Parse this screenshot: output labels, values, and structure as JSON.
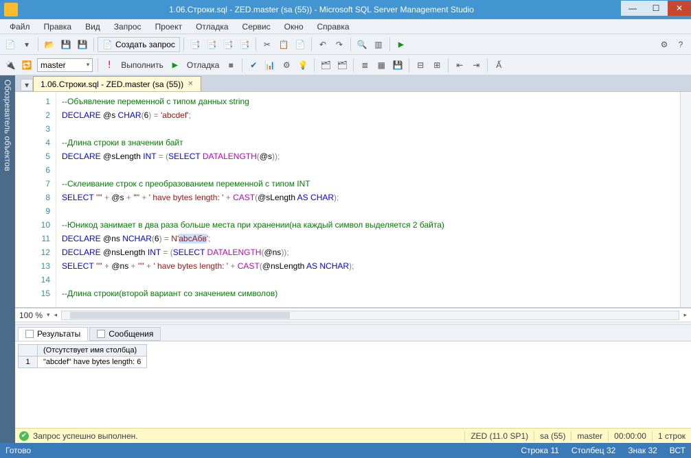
{
  "window": {
    "title": "1.06.Строки.sql - ZED.master (sa (55)) - Microsoft SQL Server Management Studio"
  },
  "menu": [
    "Файл",
    "Правка",
    "Вид",
    "Запрос",
    "Проект",
    "Отладка",
    "Сервис",
    "Окно",
    "Справка"
  ],
  "toolbar": {
    "new_query": "Создать запрос",
    "db_selected": "master",
    "execute": "Выполнить",
    "debug": "Отладка"
  },
  "sidepanel": {
    "title": "Обозреватель объектов"
  },
  "tab": {
    "label": "1.06.Строки.sql - ZED.master (sa (55))"
  },
  "code": {
    "lines": [
      {
        "n": 1,
        "tokens": [
          {
            "t": "--Объявление переменной с типом данных string",
            "c": "cm"
          }
        ]
      },
      {
        "n": 2,
        "tokens": [
          {
            "t": "DECLARE",
            "c": "kw"
          },
          {
            "t": " @s ",
            "c": "var"
          },
          {
            "t": "CHAR",
            "c": "kw"
          },
          {
            "t": "(",
            "c": "gray"
          },
          {
            "t": "6",
            "c": "var"
          },
          {
            "t": ")",
            "c": "gray"
          },
          {
            "t": " = ",
            "c": "gray"
          },
          {
            "t": "'abcdef'",
            "c": "str"
          },
          {
            "t": ";",
            "c": "gray"
          }
        ]
      },
      {
        "n": 3,
        "tokens": []
      },
      {
        "n": 4,
        "tokens": [
          {
            "t": "--Длина строки в значении байт",
            "c": "cm"
          }
        ]
      },
      {
        "n": 5,
        "tokens": [
          {
            "t": "DECLARE",
            "c": "kw"
          },
          {
            "t": " @sLength ",
            "c": "var"
          },
          {
            "t": "INT",
            "c": "kw"
          },
          {
            "t": " = ",
            "c": "gray"
          },
          {
            "t": "(",
            "c": "gray"
          },
          {
            "t": "SELECT",
            "c": "kw"
          },
          {
            "t": " ",
            "c": "var"
          },
          {
            "t": "DATALENGTH",
            "c": "fn"
          },
          {
            "t": "(",
            "c": "gray"
          },
          {
            "t": "@s",
            "c": "var"
          },
          {
            "t": "))",
            "c": "gray"
          },
          {
            "t": ";",
            "c": "gray"
          }
        ]
      },
      {
        "n": 6,
        "tokens": []
      },
      {
        "n": 7,
        "tokens": [
          {
            "t": "--Склеивание строк с преобразованием переменной с типом INT",
            "c": "cm"
          }
        ]
      },
      {
        "n": 8,
        "tokens": [
          {
            "t": "SELECT",
            "c": "kw"
          },
          {
            "t": " ",
            "c": "var"
          },
          {
            "t": "'\"'",
            "c": "str"
          },
          {
            "t": " + ",
            "c": "gray"
          },
          {
            "t": "@s",
            "c": "var"
          },
          {
            "t": " + ",
            "c": "gray"
          },
          {
            "t": "'\"'",
            "c": "str"
          },
          {
            "t": " + ",
            "c": "gray"
          },
          {
            "t": "' have bytes length: '",
            "c": "str"
          },
          {
            "t": " + ",
            "c": "gray"
          },
          {
            "t": "CAST",
            "c": "fn"
          },
          {
            "t": "(",
            "c": "gray"
          },
          {
            "t": "@sLength",
            "c": "var"
          },
          {
            "t": " ",
            "c": "var"
          },
          {
            "t": "AS",
            "c": "kw"
          },
          {
            "t": " ",
            "c": "var"
          },
          {
            "t": "CHAR",
            "c": "kw"
          },
          {
            "t": ")",
            "c": "gray"
          },
          {
            "t": ";",
            "c": "gray"
          }
        ]
      },
      {
        "n": 9,
        "tokens": []
      },
      {
        "n": 10,
        "tokens": [
          {
            "t": "--Юникод занимает в два раза больше места при хранении(на каждый символ выделяется 2 байта)",
            "c": "cm"
          }
        ]
      },
      {
        "n": 11,
        "tokens": [
          {
            "t": "DECLARE",
            "c": "kw"
          },
          {
            "t": " @ns ",
            "c": "var"
          },
          {
            "t": "NCHAR",
            "c": "kw"
          },
          {
            "t": "(",
            "c": "gray"
          },
          {
            "t": "6",
            "c": "var"
          },
          {
            "t": ")",
            "c": "gray"
          },
          {
            "t": " = ",
            "c": "gray"
          },
          {
            "t": "N",
            "c": "str"
          },
          {
            "t": "'",
            "c": "str"
          },
          {
            "t": "abcАбв",
            "c": "str",
            "sel": true
          },
          {
            "t": "'",
            "c": "str"
          },
          {
            "t": ";",
            "c": "gray"
          }
        ]
      },
      {
        "n": 12,
        "tokens": [
          {
            "t": "DECLARE",
            "c": "kw"
          },
          {
            "t": " @nsLength ",
            "c": "var"
          },
          {
            "t": "INT",
            "c": "kw"
          },
          {
            "t": " = ",
            "c": "gray"
          },
          {
            "t": "(",
            "c": "gray"
          },
          {
            "t": "SELECT",
            "c": "kw"
          },
          {
            "t": " ",
            "c": "var"
          },
          {
            "t": "DATALENGTH",
            "c": "fn"
          },
          {
            "t": "(",
            "c": "gray"
          },
          {
            "t": "@ns",
            "c": "var"
          },
          {
            "t": "))",
            "c": "gray"
          },
          {
            "t": ";",
            "c": "gray"
          }
        ]
      },
      {
        "n": 13,
        "tokens": [
          {
            "t": "SELECT",
            "c": "kw"
          },
          {
            "t": " ",
            "c": "var"
          },
          {
            "t": "'\"'",
            "c": "str"
          },
          {
            "t": " + ",
            "c": "gray"
          },
          {
            "t": "@ns",
            "c": "var"
          },
          {
            "t": " + ",
            "c": "gray"
          },
          {
            "t": "'\"'",
            "c": "str"
          },
          {
            "t": " + ",
            "c": "gray"
          },
          {
            "t": "' have bytes length: '",
            "c": "str"
          },
          {
            "t": " + ",
            "c": "gray"
          },
          {
            "t": "CAST",
            "c": "fn"
          },
          {
            "t": "(",
            "c": "gray"
          },
          {
            "t": "@nsLength",
            "c": "var"
          },
          {
            "t": " ",
            "c": "var"
          },
          {
            "t": "AS",
            "c": "kw"
          },
          {
            "t": " ",
            "c": "var"
          },
          {
            "t": "NCHAR",
            "c": "kw"
          },
          {
            "t": ")",
            "c": "gray"
          },
          {
            "t": ";",
            "c": "gray"
          }
        ]
      },
      {
        "n": 14,
        "tokens": []
      },
      {
        "n": 15,
        "tokens": [
          {
            "t": "--Длина строки(второй вариант со значением символов)",
            "c": "cm"
          }
        ]
      }
    ]
  },
  "zoom": "100 %",
  "results": {
    "tabs": {
      "results": "Результаты",
      "messages": "Сообщения"
    },
    "header": "(Отсутствует имя столбца)",
    "row1_num": "1",
    "row1_val": "\"abcdef\" have bytes length: 6"
  },
  "strip": {
    "message": "Запрос успешно выполнен.",
    "server": "ZED (11.0 SP1)",
    "login": "sa (55)",
    "database": "master",
    "time": "00:00:00",
    "rows": "1 строк"
  },
  "status": {
    "ready": "Готово",
    "line": "Строка 11",
    "col": "Столбец 32",
    "ch": "Знак 32",
    "ins": "ВСТ"
  }
}
